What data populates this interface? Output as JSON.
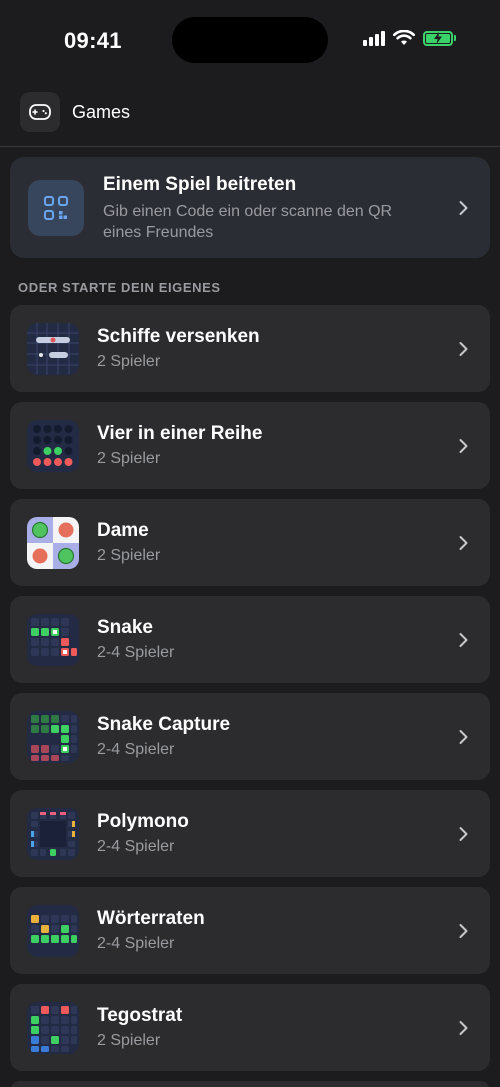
{
  "status_bar": {
    "time": "09:41"
  },
  "header": {
    "title": "Games",
    "icon": "gamepad-icon"
  },
  "join": {
    "title": "Einem Spiel beitreten",
    "subtitle": "Gib einen Code ein oder scanne den QR eines Freundes",
    "icon": "qr-code-icon"
  },
  "section_label": "ODER STARTE DEIN EIGENES",
  "games": [
    {
      "name": "Schiffe versenken",
      "players": "2 Spieler",
      "icon": "battleship-icon"
    },
    {
      "name": "Vier in einer Reihe",
      "players": "2 Spieler",
      "icon": "connect-four-icon"
    },
    {
      "name": "Dame",
      "players": "2 Spieler",
      "icon": "checkers-icon"
    },
    {
      "name": "Snake",
      "players": "2-4 Spieler",
      "icon": "snake-icon"
    },
    {
      "name": "Snake Capture",
      "players": "2-4 Spieler",
      "icon": "snake-capture-icon"
    },
    {
      "name": "Polymono",
      "players": "2-4 Spieler",
      "icon": "polymono-icon"
    },
    {
      "name": "Wörterraten",
      "players": "2-4 Spieler",
      "icon": "word-guess-icon"
    },
    {
      "name": "Tegostrat",
      "players": "2 Spieler",
      "icon": "tegostrat-icon"
    }
  ],
  "colors": {
    "background": "#1c1c1e",
    "card": "#2c2c2e",
    "join_card": "#2a2d33",
    "secondary_text": "#9a9ba0",
    "battery_green": "#3ad36a"
  }
}
